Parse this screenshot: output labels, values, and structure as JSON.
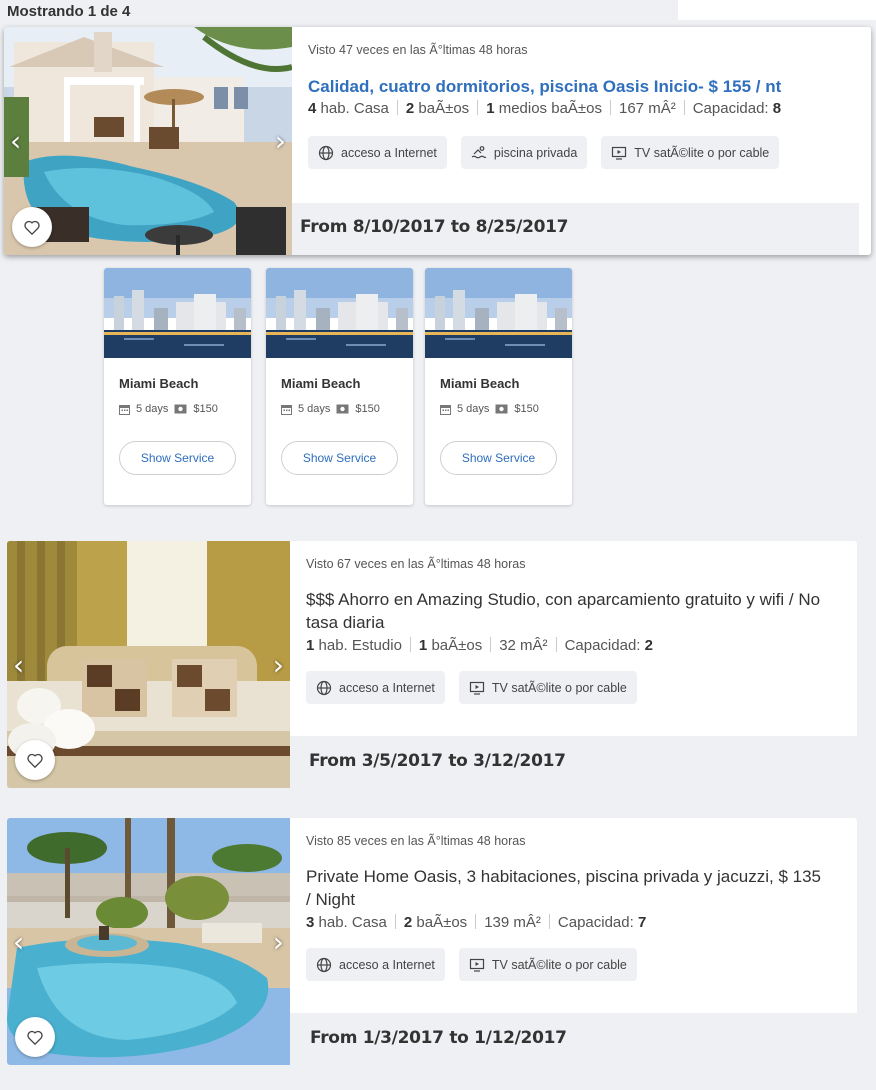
{
  "results": {
    "count_text": "Mostrando 1 de 4"
  },
  "listings": [
    {
      "views": "Visto 47 veces en las Ã°ltimas 48 horas",
      "title": "Calidad, cuatro dormitorios, piscina Oasis Inicio- $ 155 / nt",
      "specs": {
        "rooms_num": "4",
        "rooms_label": "hab. Casa",
        "baths_num": "2",
        "baths_label": "baÃ±os",
        "half_num": "1",
        "half_label": "medios baÃ±os",
        "area": "167 mÂ²",
        "capacity_label": "Capacidad:",
        "capacity_num": "8"
      },
      "amenities": [
        {
          "icon": "globe-icon",
          "label": "acceso a Internet"
        },
        {
          "icon": "pool-icon",
          "label": "piscina privada"
        },
        {
          "icon": "tv-icon",
          "label": "TV satÃ©lite o por cable"
        }
      ],
      "dates": "From 8/10/2017 to 8/25/2017"
    },
    {
      "views": "Visto 67 veces en las Ã°ltimas 48 horas",
      "title": "$$$ Ahorro en Amazing Studio, con aparcamiento gratuito y wifi / No tasa diaria",
      "specs": {
        "rooms_num": "1",
        "rooms_label": "hab. Estudio",
        "baths_num": "1",
        "baths_label": "baÃ±os",
        "area": "32 mÂ²",
        "capacity_label": "Capacidad:",
        "capacity_num": "2"
      },
      "amenities": [
        {
          "icon": "globe-icon",
          "label": "acceso a Internet"
        },
        {
          "icon": "tv-icon",
          "label": "TV satÃ©lite o por cable"
        }
      ],
      "dates": "From 3/5/2017 to 3/12/2017"
    },
    {
      "views": "Visto 85 veces en las Ã°ltimas 48 horas",
      "title": "Private Home Oasis, 3 habitaciones, piscina privada y jacuzzi, $ 135 / Night",
      "specs": {
        "rooms_num": "3",
        "rooms_label": "hab. Casa",
        "baths_num": "2",
        "baths_label": "baÃ±os",
        "area": "139 mÂ²",
        "capacity_label": "Capacidad:",
        "capacity_num": "7"
      },
      "amenities": [
        {
          "icon": "globe-icon",
          "label": "acceso a Internet"
        },
        {
          "icon": "tv-icon",
          "label": "TV satÃ©lite o por cable"
        }
      ],
      "dates": "From 1/3/2017 to 1/12/2017"
    }
  ],
  "services": [
    {
      "name": "Miami Beach",
      "days": "5 days",
      "price": "$150",
      "button": "Show Service"
    },
    {
      "name": "Miami Beach",
      "days": "5 days",
      "price": "$150",
      "button": "Show Service"
    },
    {
      "name": "Miami Beach",
      "days": "5 days",
      "price": "$150",
      "button": "Show Service"
    }
  ],
  "ui": {
    "arrow_left": "‹",
    "arrow_right": "›",
    "link_color": "#2f6fbd",
    "icons": [
      "heart-icon",
      "calendar-icon",
      "cash-icon",
      "chevron-left-icon",
      "chevron-right-icon"
    ]
  }
}
